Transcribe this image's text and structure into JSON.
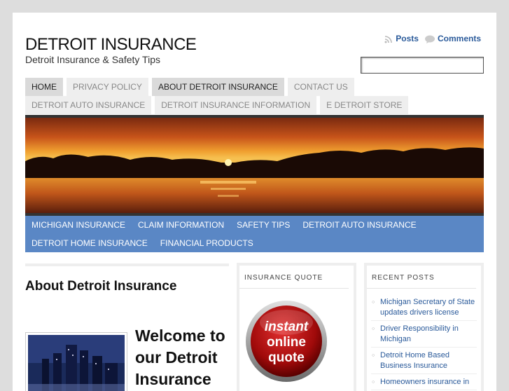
{
  "header": {
    "title": "DETROIT INSURANCE",
    "description": "Detroit Insurance & Safety Tips",
    "feeds": {
      "posts_label": "Posts",
      "comments_label": "Comments"
    },
    "search": {
      "value": "",
      "placeholder": ""
    }
  },
  "nav_primary": {
    "items": [
      {
        "label": "HOME",
        "state": "active"
      },
      {
        "label": "PRIVACY POLICY",
        "state": "normal"
      },
      {
        "label": "ABOUT DETROIT INSURANCE",
        "state": "current"
      },
      {
        "label": "CONTACT US",
        "state": "normal"
      },
      {
        "label": "DETROIT AUTO INSURANCE",
        "state": "normal"
      },
      {
        "label": "DETROIT INSURANCE INFORMATION",
        "state": "normal"
      },
      {
        "label": "E DETROIT STORE",
        "state": "normal"
      }
    ]
  },
  "nav_secondary": {
    "items": [
      "MICHIGAN INSURANCE",
      "CLAIM INFORMATION",
      "SAFETY TIPS",
      "DETROIT AUTO INSURANCE",
      "DETROIT HOME INSURANCE",
      "FINANCIAL PRODUCTS"
    ]
  },
  "main": {
    "page_title": "About Detroit Insurance",
    "welcome_heading": "Welcome to our Detroit Insurance"
  },
  "sidebar": {
    "quote_widget": {
      "title": "INSURANCE QUOTE",
      "button_lines": [
        "instant",
        "online",
        "quote"
      ]
    },
    "recent_posts": {
      "title": "RECENT POSTS",
      "items": [
        "Michigan Secretary of State updates drivers license",
        "Driver Responsibility in Michigan",
        "Detroit Home Based Business Insurance",
        "Homeowners insurance in"
      ]
    }
  },
  "colors": {
    "accent_nav": "#5a87c5",
    "link": "#2a5a9a",
    "page_bg": "#dddddd"
  }
}
